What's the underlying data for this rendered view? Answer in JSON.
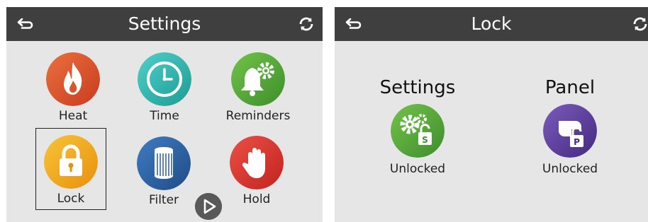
{
  "left_screen": {
    "title": "Settings",
    "back_icon": "back-arrow-icon",
    "refresh_icon": "refresh-icon",
    "tiles": [
      {
        "label": "Heat",
        "icon": "flame-icon",
        "color": "#d9532b"
      },
      {
        "label": "Time",
        "icon": "clock-icon",
        "color": "#2bb5b0"
      },
      {
        "label": "Reminders",
        "icon": "bell-gear-icon",
        "color": "#5aae3c"
      },
      {
        "label": "Lock",
        "icon": "padlock-icon",
        "color": "#f2a81c"
      },
      {
        "label": "Filter",
        "icon": "filter-cartridge-icon",
        "color": "#2a5d9e"
      },
      {
        "label": "Hold",
        "icon": "hand-stop-icon",
        "color": "#d9302a"
      }
    ],
    "next_icon": "play-next-icon"
  },
  "right_screen": {
    "title": "Lock",
    "back_icon": "back-arrow-icon",
    "refresh_icon": "refresh-icon",
    "locks": [
      {
        "heading": "Settings",
        "state": "Unlocked",
        "icon": "settings-unlock-icon",
        "color": "#5aae3c",
        "badge_letter": "S"
      },
      {
        "heading": "Panel",
        "state": "Unlocked",
        "icon": "panel-unlock-icon",
        "color": "#5a3f9a",
        "badge_letter": "P"
      }
    ]
  }
}
